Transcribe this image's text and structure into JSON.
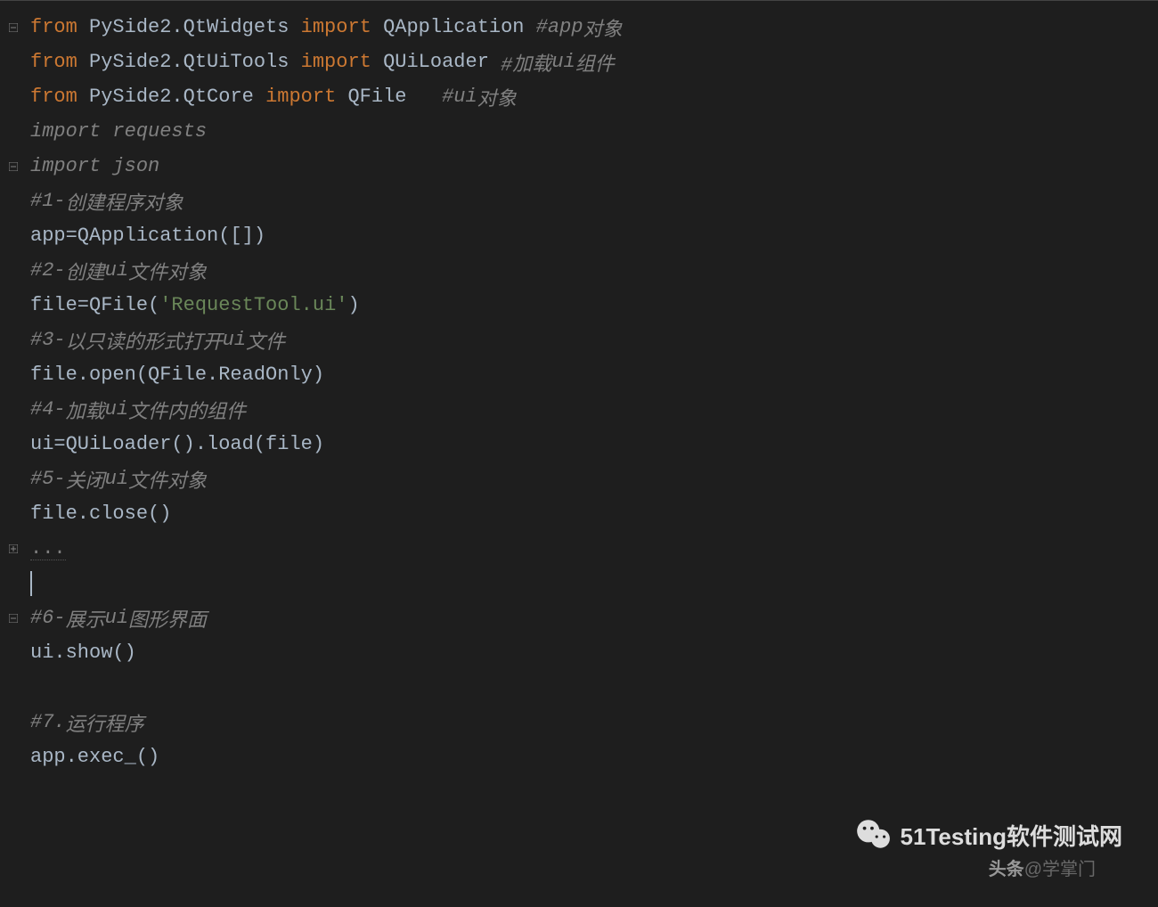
{
  "code": {
    "lines": [
      {
        "type": "code",
        "tokens": [
          {
            "cls": "kw",
            "t": "from "
          },
          {
            "cls": "normal",
            "t": "PySide2.QtWidgets "
          },
          {
            "cls": "kw",
            "t": "import "
          },
          {
            "cls": "normal",
            "t": "QApplication "
          },
          {
            "cls": "comment-it",
            "t": "#app"
          },
          {
            "cls": "comment-zh",
            "t": "对象"
          }
        ],
        "gutter": "collapse"
      },
      {
        "type": "code",
        "tokens": [
          {
            "cls": "kw",
            "t": "from "
          },
          {
            "cls": "normal",
            "t": "PySide2.QtUiTools "
          },
          {
            "cls": "kw",
            "t": "import "
          },
          {
            "cls": "normal",
            "t": "QUiLoader "
          },
          {
            "cls": "comment-zh",
            "t": "#加载"
          },
          {
            "cls": "comment-it",
            "t": "ui"
          },
          {
            "cls": "comment-zh",
            "t": "组件"
          }
        ]
      },
      {
        "type": "code",
        "tokens": [
          {
            "cls": "kw",
            "t": "from "
          },
          {
            "cls": "normal",
            "t": "PySide2.QtCore "
          },
          {
            "cls": "kw",
            "t": "import "
          },
          {
            "cls": "normal",
            "t": "QFile   "
          },
          {
            "cls": "comment-it",
            "t": "#ui"
          },
          {
            "cls": "comment-zh",
            "t": "对象"
          }
        ]
      },
      {
        "type": "code",
        "tokens": [
          {
            "cls": "comment-it",
            "t": "import requests"
          }
        ]
      },
      {
        "type": "code",
        "tokens": [
          {
            "cls": "comment-it",
            "t": "import json"
          }
        ],
        "gutter": "collapse"
      },
      {
        "type": "code",
        "tokens": [
          {
            "cls": "comment-it",
            "t": "#1-"
          },
          {
            "cls": "comment-zh",
            "t": "创建程序对象"
          }
        ]
      },
      {
        "type": "code",
        "tokens": [
          {
            "cls": "normal",
            "t": "app=QApplication([])"
          }
        ]
      },
      {
        "type": "code",
        "tokens": [
          {
            "cls": "comment-it",
            "t": "#2-"
          },
          {
            "cls": "comment-zh",
            "t": "创建"
          },
          {
            "cls": "comment-it",
            "t": "ui"
          },
          {
            "cls": "comment-zh",
            "t": "文件对象"
          }
        ]
      },
      {
        "type": "code",
        "tokens": [
          {
            "cls": "normal",
            "t": "file=QFile("
          },
          {
            "cls": "string",
            "t": "'RequestTool.ui'"
          },
          {
            "cls": "normal",
            "t": ")"
          }
        ]
      },
      {
        "type": "code",
        "tokens": [
          {
            "cls": "comment-it",
            "t": "#3-"
          },
          {
            "cls": "comment-zh",
            "t": "以只读的形式打开"
          },
          {
            "cls": "comment-it",
            "t": "ui"
          },
          {
            "cls": "comment-zh",
            "t": "文件"
          }
        ]
      },
      {
        "type": "code",
        "tokens": [
          {
            "cls": "normal",
            "t": "file.open(QFile.ReadOnly)"
          }
        ]
      },
      {
        "type": "code",
        "tokens": [
          {
            "cls": "comment-it",
            "t": "#4-"
          },
          {
            "cls": "comment-zh",
            "t": "加载"
          },
          {
            "cls": "comment-it",
            "t": "ui"
          },
          {
            "cls": "comment-zh",
            "t": "文件内的组件"
          }
        ]
      },
      {
        "type": "code",
        "tokens": [
          {
            "cls": "normal",
            "t": "ui=QUiLoader().load(file)"
          }
        ]
      },
      {
        "type": "code",
        "tokens": [
          {
            "cls": "comment-it",
            "t": "#5-"
          },
          {
            "cls": "comment-zh",
            "t": "关闭"
          },
          {
            "cls": "comment-it",
            "t": "ui"
          },
          {
            "cls": "comment-zh",
            "t": "文件对象"
          }
        ]
      },
      {
        "type": "code",
        "tokens": [
          {
            "cls": "normal",
            "t": "file.close()"
          }
        ]
      },
      {
        "type": "folded",
        "tokens": [
          {
            "cls": "folded",
            "t": "..."
          }
        ],
        "gutter": "expand"
      },
      {
        "type": "cursor",
        "tokens": []
      },
      {
        "type": "code",
        "tokens": [
          {
            "cls": "comment-it",
            "t": "#6-"
          },
          {
            "cls": "comment-zh",
            "t": "展示"
          },
          {
            "cls": "comment-it",
            "t": "ui"
          },
          {
            "cls": "comment-zh",
            "t": "图形界面"
          }
        ],
        "gutter": "collapse"
      },
      {
        "type": "code",
        "tokens": [
          {
            "cls": "normal",
            "t": "ui.show()"
          }
        ]
      },
      {
        "type": "blank",
        "tokens": []
      },
      {
        "type": "code",
        "tokens": [
          {
            "cls": "comment-it",
            "t": "#7."
          },
          {
            "cls": "comment-zh",
            "t": "运行程序"
          }
        ]
      },
      {
        "type": "code",
        "tokens": [
          {
            "cls": "normal",
            "t": "app.exec_()"
          }
        ]
      },
      {
        "type": "blank",
        "tokens": []
      }
    ]
  },
  "watermark1": "51Testing软件测试网",
  "watermark2_prefix": "头条",
  "watermark2_suffix": "@学掌门"
}
